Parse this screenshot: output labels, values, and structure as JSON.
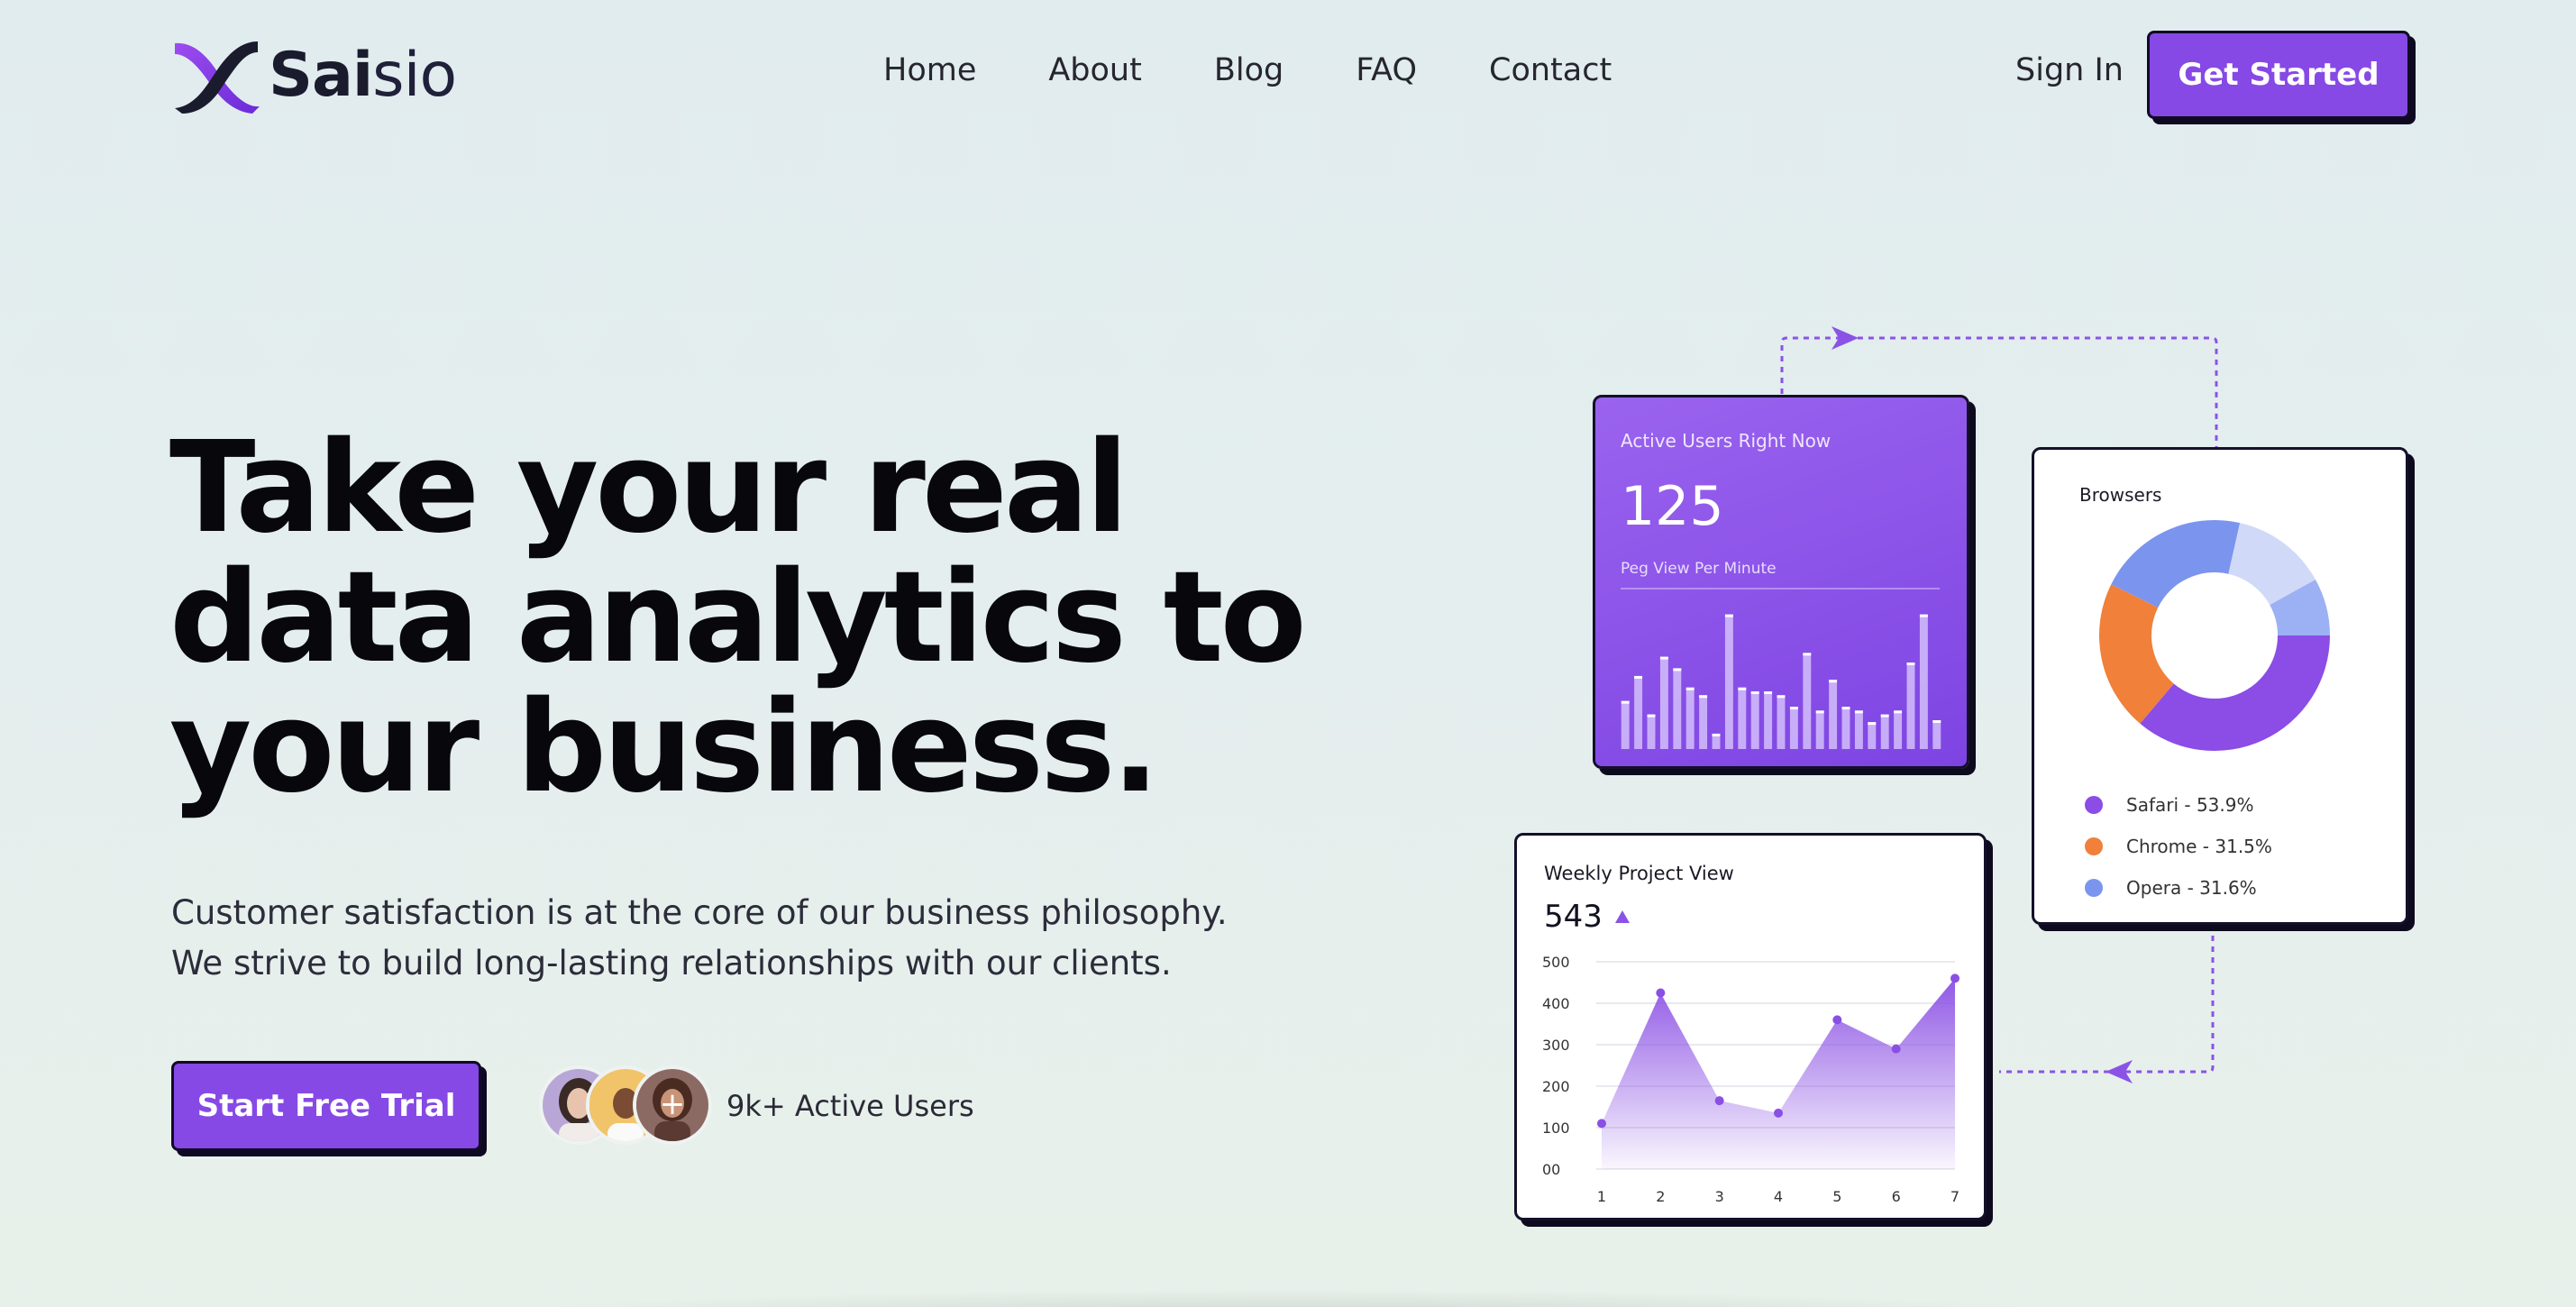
{
  "brand": {
    "name_bold": "Sai",
    "name_light": "sio",
    "accent": "#8649e5",
    "dark": "#110a26"
  },
  "nav": {
    "items": [
      "Home",
      "About",
      "Blog",
      "FAQ",
      "Contact"
    ],
    "signin": "Sign In",
    "cta": "Get Started"
  },
  "hero": {
    "title": "Take your real data analytics to your business.",
    "subtitle": "Customer satisfaction is at the core of our business philosophy. We strive to build long-lasting relationships with our clients.",
    "trial_button": "Start Free Trial",
    "users_label": "9k+ Active Users",
    "plus_icon": "+"
  },
  "active_users_card": {
    "title": "Active Users Right Now",
    "value": "125",
    "subtitle": "Peg View Per Minute",
    "chart_data": {
      "type": "bar",
      "values": [
        25,
        38,
        18,
        48,
        42,
        32,
        28,
        8,
        70,
        32,
        30,
        30,
        28,
        22,
        50,
        20,
        36,
        22,
        20,
        14,
        18,
        20,
        45,
        70,
        15
      ]
    }
  },
  "browsers_card": {
    "title": "Browsers",
    "chart_data": {
      "type": "pie",
      "slices": [
        {
          "label": "Safari - 53.9%",
          "value": 53.9,
          "color": "#8c4ce6",
          "legend": true
        },
        {
          "label": "Chrome - 31.5%",
          "value": 31.5,
          "color": "#f0803a",
          "legend": true
        },
        {
          "label": "Opera - 31.6%",
          "value": 31.6,
          "color": "#7b95ee",
          "legend": true
        },
        {
          "label": "",
          "value": 20,
          "color": "#d0d9f7",
          "legend": false
        },
        {
          "label": "",
          "value": 12,
          "color": "#9cb1f3",
          "legend": false
        }
      ]
    }
  },
  "weekly_card": {
    "title": "Weekly Project View",
    "value": "543",
    "chart_data": {
      "type": "area",
      "x": [
        1,
        2,
        3,
        4,
        5,
        6,
        7
      ],
      "y": [
        110,
        425,
        165,
        135,
        360,
        290,
        460
      ],
      "ytick_labels": [
        "00",
        "100",
        "200",
        "300",
        "400",
        "500"
      ],
      "ylim": [
        0,
        500
      ]
    }
  }
}
